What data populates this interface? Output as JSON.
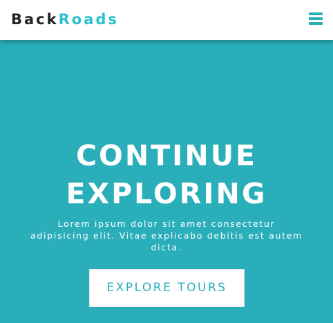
{
  "navbar": {
    "logo_primary": "Back",
    "logo_accent": "Roads",
    "menu_icon": "hamburger-menu-icon"
  },
  "hero": {
    "title_line1": "CONTINUE",
    "title_line2": "EXPLORING",
    "text": "Lorem ipsum dolor sit amet consectetur adipisicing elit. Vitae explicabo debitis est autem dicta.",
    "button_label": "EXPLORE TOURS"
  },
  "colors": {
    "primary": "#2aaeba",
    "logo_accent": "#2cc1d0",
    "logo_dark": "#222222",
    "navbar_bg": "#ffffff"
  }
}
